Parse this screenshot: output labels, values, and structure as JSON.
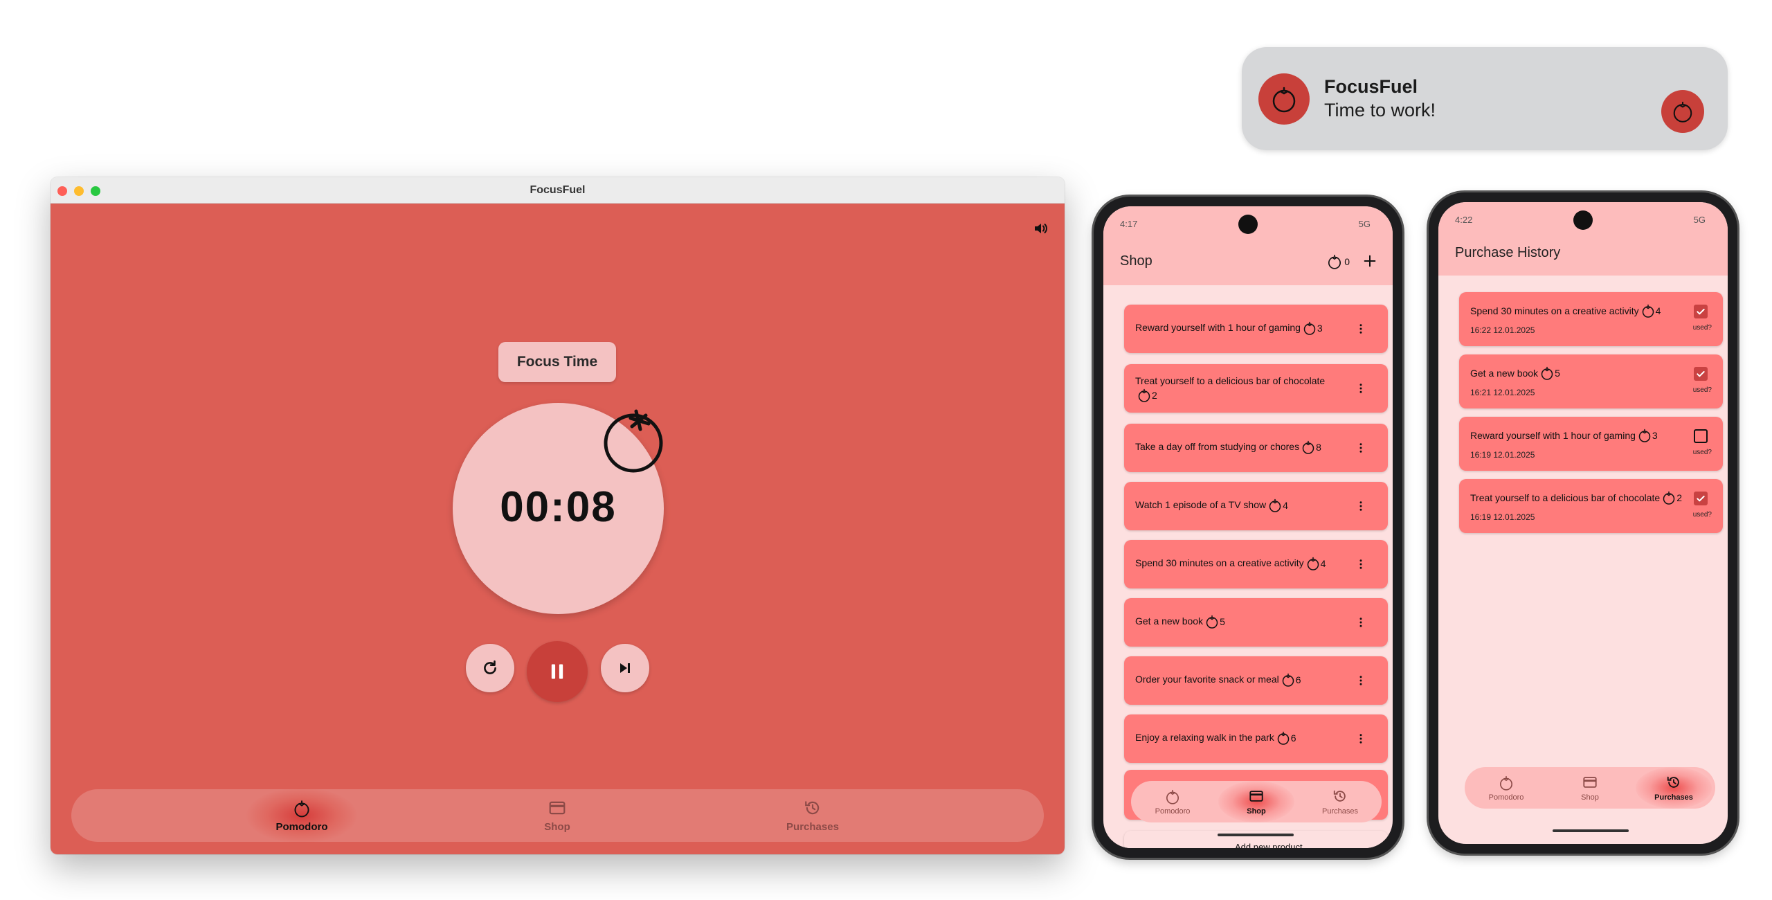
{
  "notification": {
    "app_name": "FocusFuel",
    "message": "Time to work!",
    "icon": "tomato-icon"
  },
  "desktop": {
    "window_title": "FocusFuel",
    "phase_label": "Focus Time",
    "timer": "00:08",
    "controls": [
      "restart-icon",
      "pause-icon",
      "skip-next-icon"
    ],
    "nav": [
      {
        "label": "Pomodoro",
        "icon": "tomato-icon",
        "active": true
      },
      {
        "label": "Shop",
        "icon": "card-icon",
        "active": false
      },
      {
        "label": "Purchases",
        "icon": "history-icon",
        "active": false
      }
    ]
  },
  "shop_phone": {
    "status_time": "4:17",
    "status_right": "5G",
    "title": "Shop",
    "balance": "0",
    "items": [
      {
        "text": "Reward yourself with 1 hour of gaming",
        "price": "3"
      },
      {
        "text": "Treat yourself to a delicious bar of chocolate",
        "price": "2"
      },
      {
        "text": "Take a day off from studying or chores",
        "price": "8"
      },
      {
        "text": "Watch 1 episode of a TV show",
        "price": "4"
      },
      {
        "text": "Spend 30 minutes on a creative activity",
        "price": "4"
      },
      {
        "text": "Get a new book",
        "price": "5"
      },
      {
        "text": "Order your favorite snack or meal",
        "price": "6"
      },
      {
        "text": "Enjoy a relaxing walk in the park",
        "price": "6"
      }
    ],
    "add_product_label": "Add new product",
    "nav": [
      {
        "label": "Pomodoro",
        "active": false
      },
      {
        "label": "Shop",
        "active": true
      },
      {
        "label": "Purchases",
        "active": false
      }
    ]
  },
  "purchases_phone": {
    "status_time": "4:22",
    "status_right": "5G",
    "title": "Purchase History",
    "items": [
      {
        "text": "Spend 30 minutes on a creative activity",
        "price": "4",
        "date": "16:22 12.01.2025",
        "used": true
      },
      {
        "text": "Get a new book",
        "price": "5",
        "date": "16:21 12.01.2025",
        "used": true
      },
      {
        "text": "Reward yourself with 1 hour of gaming",
        "price": "3",
        "date": "16:19 12.01.2025",
        "used": false
      },
      {
        "text": "Treat yourself to a delicious bar of chocolate",
        "price": "2",
        "date": "16:19 12.01.2025",
        "used": true
      }
    ],
    "used_label": "used?",
    "nav": [
      {
        "label": "Pomodoro",
        "active": false
      },
      {
        "label": "Shop",
        "active": false
      },
      {
        "label": "Purchases",
        "active": true
      }
    ]
  },
  "colors": {
    "desktop_bg": "#dc5e55",
    "accent_dark": "#c8403a",
    "dial": "#f4c2c2",
    "phone_card": "#ff7b7b",
    "phone_bar": "#fdbcbc",
    "checkbox": "#c94242"
  }
}
